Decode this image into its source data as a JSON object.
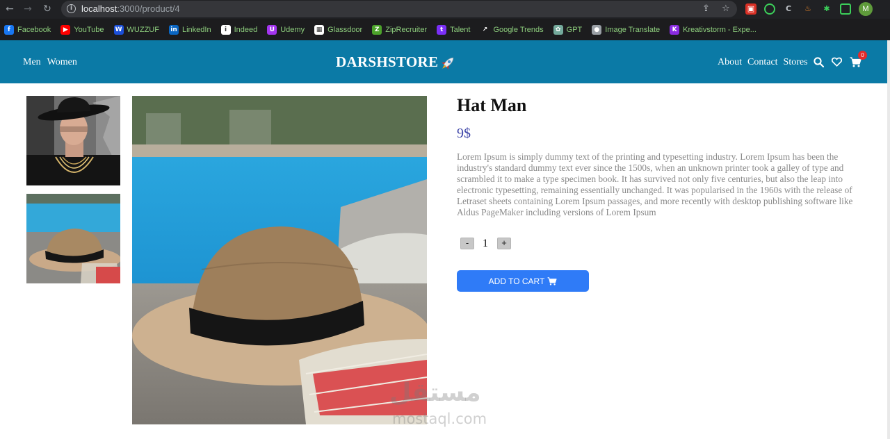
{
  "browser": {
    "url_host": "localhost",
    "url_path": ":3000/product/4",
    "profile_initial": "M",
    "bookmarks": [
      {
        "label": "Facebook",
        "icon": "facebook-icon",
        "color": "#1877f2",
        "glyph": "f"
      },
      {
        "label": "YouTube",
        "icon": "youtube-icon",
        "color": "#ff0000",
        "glyph": "▶"
      },
      {
        "label": "WUZZUF",
        "icon": "wuzzuf-icon",
        "color": "#1b4fd8",
        "glyph": "W"
      },
      {
        "label": "LinkedIn",
        "icon": "linkedin-icon",
        "color": "#0a66c2",
        "glyph": "in"
      },
      {
        "label": "Indeed",
        "icon": "indeed-icon",
        "color": "#ffffff",
        "glyph": "i"
      },
      {
        "label": "Udemy",
        "icon": "udemy-icon",
        "color": "#a435f0",
        "glyph": "U"
      },
      {
        "label": "Glassdoor",
        "icon": "glassdoor-icon",
        "color": "#ffffff",
        "glyph": "▦"
      },
      {
        "label": "ZipRecruiter",
        "icon": "ziprecruiter-icon",
        "color": "#4ca32b",
        "glyph": "Z"
      },
      {
        "label": "Talent",
        "icon": "talent-icon",
        "color": "#7b2ff7",
        "glyph": "t"
      },
      {
        "label": "Google Trends",
        "icon": "google-trends-icon",
        "color": "#1c1c1e",
        "glyph": "↗"
      },
      {
        "label": "GPT",
        "icon": "gpt-icon",
        "color": "#74aa9c",
        "glyph": "✿"
      },
      {
        "label": "Image Translate",
        "icon": "image-translate-icon",
        "color": "#9aa0a6",
        "glyph": "●"
      },
      {
        "label": "Kreativstorm - Expe...",
        "icon": "kreativstorm-icon",
        "color": "#8a2be2",
        "glyph": "K"
      }
    ]
  },
  "header": {
    "nav_left": [
      "Men",
      "Women"
    ],
    "brand": "DARSHSTORE",
    "nav_right": [
      "About",
      "Contact",
      "Stores"
    ],
    "cart_count": "0",
    "bg_color": "#0b7aa6"
  },
  "product": {
    "title": "Hat Man",
    "price": "9$",
    "description": "Lorem Ipsum is simply dummy text of the printing and typesetting industry. Lorem Ipsum has been the industry's standard dummy text ever since the 1500s, when an unknown printer took a galley of type and scrambled it to make a type specimen book. It has survived not only five centuries, but also the leap into electronic typesetting, remaining essentially unchanged. It was popularised in the 1960s with the release of Letraset sheets containing Lorem Ipsum passages, and more recently with desktop publishing software like Aldus PageMaker including versions of Lorem Ipsum",
    "quantity": "1",
    "decrement_label": "-",
    "increment_label": "+",
    "add_to_cart_label": "ADD TO CART",
    "price_color": "#3d44a8",
    "button_color": "#2f7bf7"
  },
  "watermark": {
    "arabic": "مستقل",
    "latin": "mostaql.com"
  }
}
